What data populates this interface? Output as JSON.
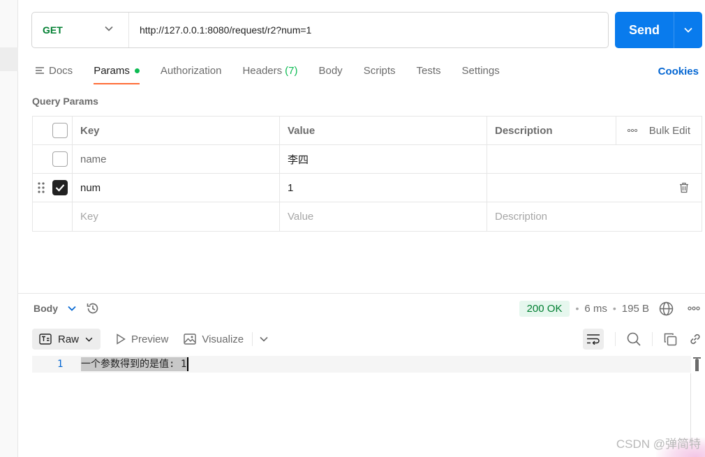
{
  "request": {
    "method": "GET",
    "url": "http://127.0.0.1:8080/request/r2?num=1",
    "send_label": "Send"
  },
  "tabs": {
    "docs": "Docs",
    "params": "Params",
    "authorization": "Authorization",
    "headers": "Headers",
    "headers_count": "(7)",
    "body": "Body",
    "scripts": "Scripts",
    "tests": "Tests",
    "settings": "Settings",
    "cookies": "Cookies"
  },
  "query_params": {
    "title": "Query Params",
    "columns": {
      "key": "Key",
      "value": "Value",
      "description": "Description",
      "bulk_edit": "Bulk Edit"
    },
    "rows": [
      {
        "key": "name",
        "value": "李四",
        "description": "",
        "checked": false
      },
      {
        "key": "num",
        "value": "1",
        "description": "",
        "checked": true
      }
    ],
    "placeholders": {
      "key": "Key",
      "value": "Value",
      "description": "Description"
    }
  },
  "response": {
    "section_label": "Body",
    "status": "200 OK",
    "time": "6 ms",
    "size": "195 B",
    "view_mode": "Raw",
    "preview_label": "Preview",
    "visualize_label": "Visualize",
    "line_number": "1",
    "body_text": "一个参数得到的是值: 1"
  },
  "watermark": "CSDN @弹简特",
  "colors": {
    "accent_send": "#097bed",
    "method_get": "#007f31",
    "tab_underline": "#ff6c37",
    "status_ok": "#007f31",
    "link": "#0265d2"
  }
}
